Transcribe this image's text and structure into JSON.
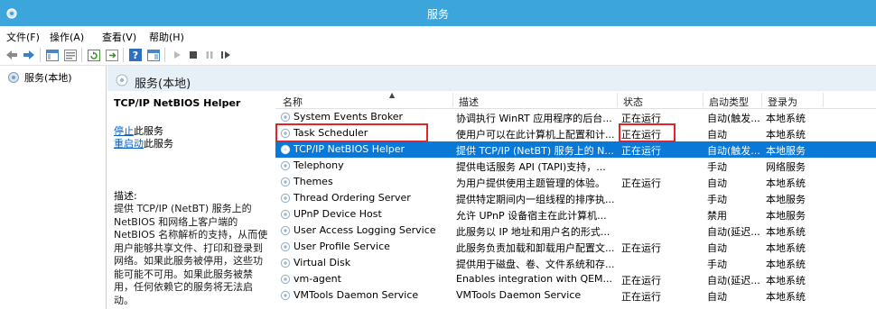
{
  "window": {
    "title": "服务"
  },
  "menu": [
    "文件(F)",
    "操作(A)",
    "查看(V)",
    "帮助(H)"
  ],
  "tree": {
    "item": "服务(本地)"
  },
  "content": {
    "header": "服务(本地)",
    "description_pane": {
      "service_name": "TCP/IP NetBIOS Helper",
      "stop_link": "停止",
      "stop_suffix": "此服务",
      "restart_link": "重启动",
      "restart_suffix": "此服务",
      "desc_label": "描述:",
      "desc_text": "提供 TCP/IP (NetBT) 服务上的 NetBIOS 和网络上客户端的 NetBIOS 名称解析的支持，从而使用户能够共享文件、打印和登录到网络。如果此服务被停用，这些功能可能不可用。如果此服务被禁用，任何依赖它的服务将无法启动。"
    },
    "columns": [
      "名称",
      "描述",
      "状态",
      "启动类型",
      "登录为"
    ],
    "rows": [
      {
        "name": "System Events Broker",
        "desc": "协调执行 WinRT 应用程序的后台...",
        "state": "正在运行",
        "start": "自动(触发...",
        "logon": "本地系统"
      },
      {
        "name": "Task Scheduler",
        "desc": "使用户可以在此计算机上配置和计...",
        "state": "正在运行",
        "start": "自动",
        "logon": "本地系统"
      },
      {
        "name": "TCP/IP NetBIOS Helper",
        "desc": "提供 TCP/IP (NetBT) 服务上的 N...",
        "state": "正在运行",
        "start": "自动(触发...",
        "logon": "本地服务",
        "selected": true
      },
      {
        "name": "Telephony",
        "desc": "提供电话服务 API (TAPI)支持，...",
        "state": "",
        "start": "手动",
        "logon": "网络服务"
      },
      {
        "name": "Themes",
        "desc": "为用户提供使用主题管理的体验。",
        "state": "正在运行",
        "start": "自动",
        "logon": "本地系统"
      },
      {
        "name": "Thread Ordering Server",
        "desc": "提供特定期间内一组线程的排序执...",
        "state": "",
        "start": "手动",
        "logon": "本地服务"
      },
      {
        "name": "UPnP Device Host",
        "desc": "允许 UPnP 设备宿主在此计算机...",
        "state": "",
        "start": "禁用",
        "logon": "本地服务"
      },
      {
        "name": "User Access Logging Service",
        "desc": "此服务以 IP 地址和用户名的形式...",
        "state": "",
        "start": "自动(延迟...",
        "logon": "本地系统"
      },
      {
        "name": "User Profile Service",
        "desc": "此服务负责加载和卸载用户配置文...",
        "state": "正在运行",
        "start": "自动",
        "logon": "本地系统"
      },
      {
        "name": "Virtual Disk",
        "desc": "提供用于磁盘、卷、文件系统和存...",
        "state": "",
        "start": "手动",
        "logon": "本地系统"
      },
      {
        "name": "vm-agent",
        "desc": "Enables integration with QEM...",
        "state": "正在运行",
        "start": "自动(延迟...",
        "logon": "本地系统"
      },
      {
        "name": "VMTools Daemon Service",
        "desc": "VMTools Daemon Service",
        "state": "正在运行",
        "start": "自动",
        "logon": "本地系统"
      }
    ]
  },
  "colors": {
    "titlebar": "#3ba5dc",
    "selection": "#0a78d7",
    "highlight": "#e0242b",
    "link": "#0a5fc4"
  }
}
